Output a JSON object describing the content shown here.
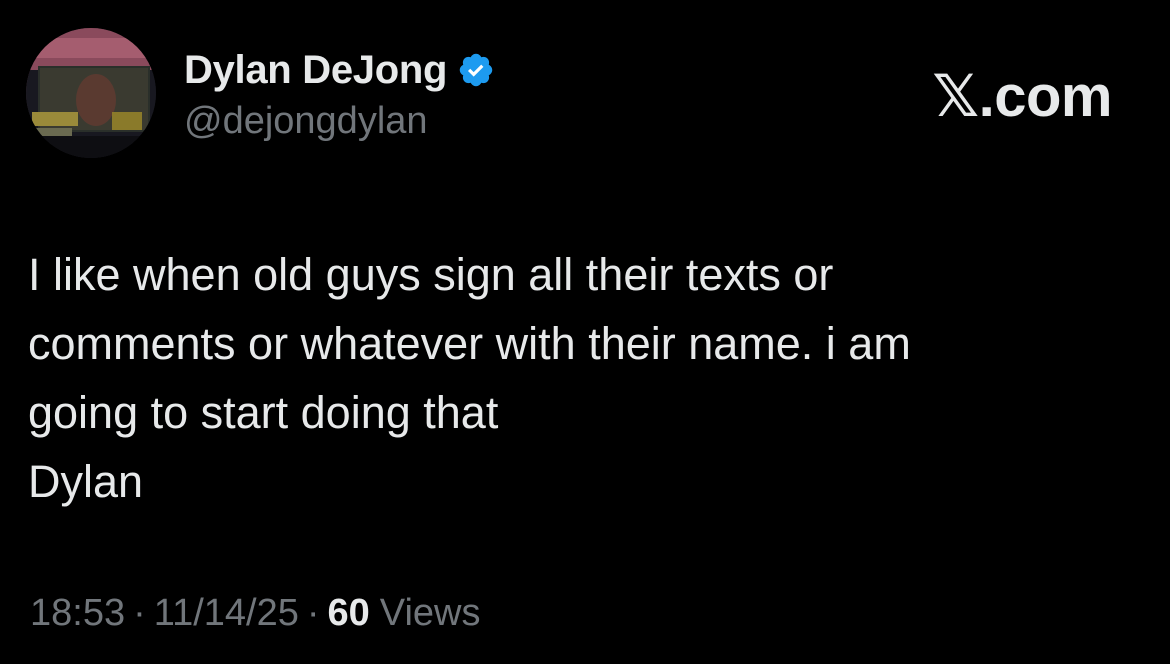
{
  "author": {
    "display_name": "Dylan DeJong",
    "handle": "@dejongdylan",
    "verified": true,
    "avatar_icon": "profile-photo"
  },
  "brand": {
    "label": "𝕏.com"
  },
  "tweet": {
    "lines": [
      "I like when old guys sign all their texts or",
      "comments or whatever with their name. i am",
      "going to start doing that",
      "Dylan"
    ]
  },
  "meta": {
    "time": "18:53",
    "separator": "·",
    "date": "11/14/25",
    "views_count": "60",
    "views_label": "Views"
  },
  "colors": {
    "background": "#000000",
    "text_primary": "#e7e9ea",
    "text_secondary": "#71767b",
    "verified_blue": "#1d9bf0"
  }
}
